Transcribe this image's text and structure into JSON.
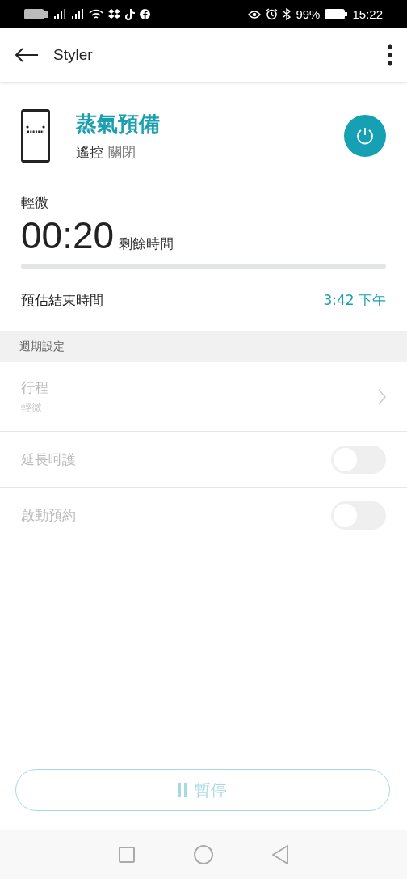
{
  "status_bar": {
    "battery": "99%",
    "time": "15:22"
  },
  "app_bar": {
    "title": "Styler"
  },
  "device": {
    "status": "蒸氣預備",
    "remote_label": "遙控",
    "remote_value": "關閉"
  },
  "cycle": {
    "name": "輕微",
    "remaining": "00:20",
    "remaining_label": "剩餘時間",
    "progress": {
      "level": 0
    }
  },
  "end_time": {
    "label": "預估結束時間",
    "value": "3:42 下午"
  },
  "section": {
    "title": "週期設定"
  },
  "settings": [
    {
      "kind": "link",
      "label": "行程",
      "value": "輕微",
      "disabled": true
    },
    {
      "kind": "toggle",
      "label": "延長呵護",
      "on": false,
      "disabled": true
    },
    {
      "kind": "toggle",
      "label": "啟動預約",
      "on": false,
      "disabled": true
    }
  ],
  "pause_button": {
    "label": "暫停",
    "disabled": true
  }
}
